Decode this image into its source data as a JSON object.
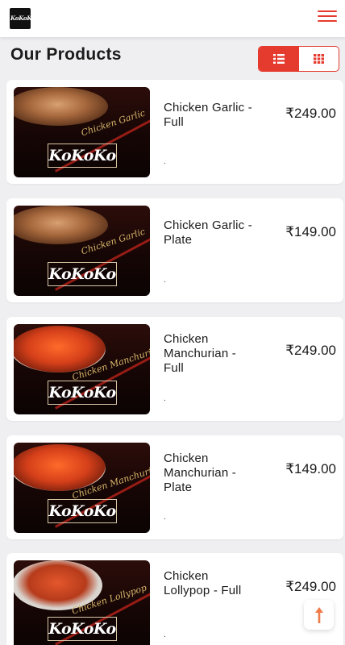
{
  "header": {
    "logo_text": "KoKoKo"
  },
  "page": {
    "title": "Our Products"
  },
  "view_toggle": {
    "active": "list"
  },
  "colors": {
    "accent": "#e53b2f"
  },
  "products": [
    {
      "name": "Chicken Garlic - Full",
      "price": "₹249.00",
      "image_script": "Chicken Garlic",
      "brand": "KoKoKo",
      "dot": "."
    },
    {
      "name": "Chicken Garlic - Plate",
      "price": "₹149.00",
      "image_script": "Chicken Garlic",
      "brand": "KoKoKo",
      "dot": "."
    },
    {
      "name": "Chicken Manchurian - Full",
      "price": "₹249.00",
      "image_script": "Chicken Manchurian",
      "brand": "KoKoKo",
      "dot": "."
    },
    {
      "name": "Chicken Manchurian - Plate",
      "price": "₹149.00",
      "image_script": "Chicken Manchurian",
      "brand": "KoKoKo",
      "dot": "."
    },
    {
      "name": "Chicken Lollypop - Full",
      "price": "₹249.00",
      "image_script": "Chicken Lollypop",
      "brand": "KoKoKo",
      "dot": "."
    }
  ]
}
